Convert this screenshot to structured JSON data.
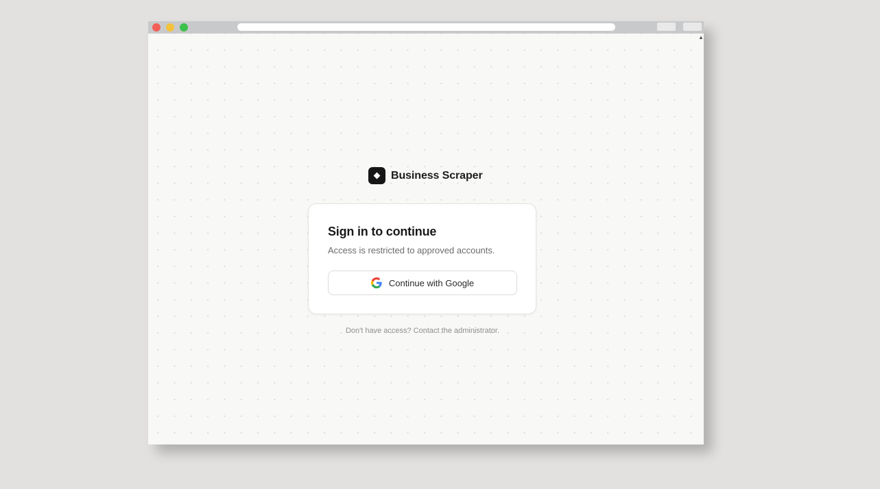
{
  "browser": {
    "window_controls": [
      "close",
      "minimize",
      "maximize"
    ]
  },
  "brand": {
    "name": "Business Scraper",
    "logo_icon": "diamond-icon"
  },
  "signin": {
    "title": "Sign in to continue",
    "subtitle": "Access is restricted to approved accounts.",
    "google_button_label": "Continue with Google",
    "google_icon": "google-icon"
  },
  "footer": {
    "note": "Don't have access? Contact the administrator."
  },
  "colors": {
    "desktop_background": "#e2e1df",
    "page_background": "#f8f8f7",
    "brand_logo": "#161616",
    "close_dot": "#f25f58",
    "minimize_dot": "#f3c23c",
    "maximize_dot": "#3bc14a"
  }
}
